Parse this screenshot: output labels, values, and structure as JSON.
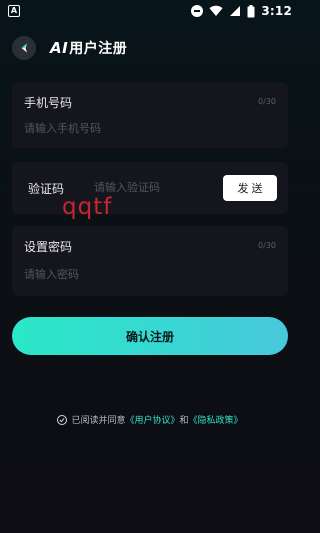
{
  "status_bar": {
    "left_icon_letter": "A",
    "time": "3:12",
    "icons": [
      "app-icon",
      "do-not-disturb-icon",
      "wifi-icon",
      "signal-icon",
      "battery-icon"
    ]
  },
  "header": {
    "title_prefix": "AI",
    "title": "用户注册",
    "back_icon": "back-arrow-icon"
  },
  "form": {
    "phone": {
      "label": "手机号码",
      "placeholder": "请输入手机号码",
      "value": "",
      "count": "0/30"
    },
    "code": {
      "label": "验证码",
      "placeholder": "请输入验证码",
      "value": "",
      "send_label": "发送"
    },
    "password": {
      "label": "设置密码",
      "placeholder": "请输入密码",
      "value": "",
      "count": "0/30"
    },
    "submit_label": "确认注册"
  },
  "overlay_text": "qqtf",
  "agreement": {
    "prefix": "已阅读并同意",
    "user_agreement": "《用户协议》",
    "and": "和",
    "privacy_policy": "《隐私政策》",
    "checked": true
  },
  "colors": {
    "accent": "#2be8c7",
    "link": "#2ee0c6",
    "card": "#15161d",
    "background": "#0b1014"
  }
}
